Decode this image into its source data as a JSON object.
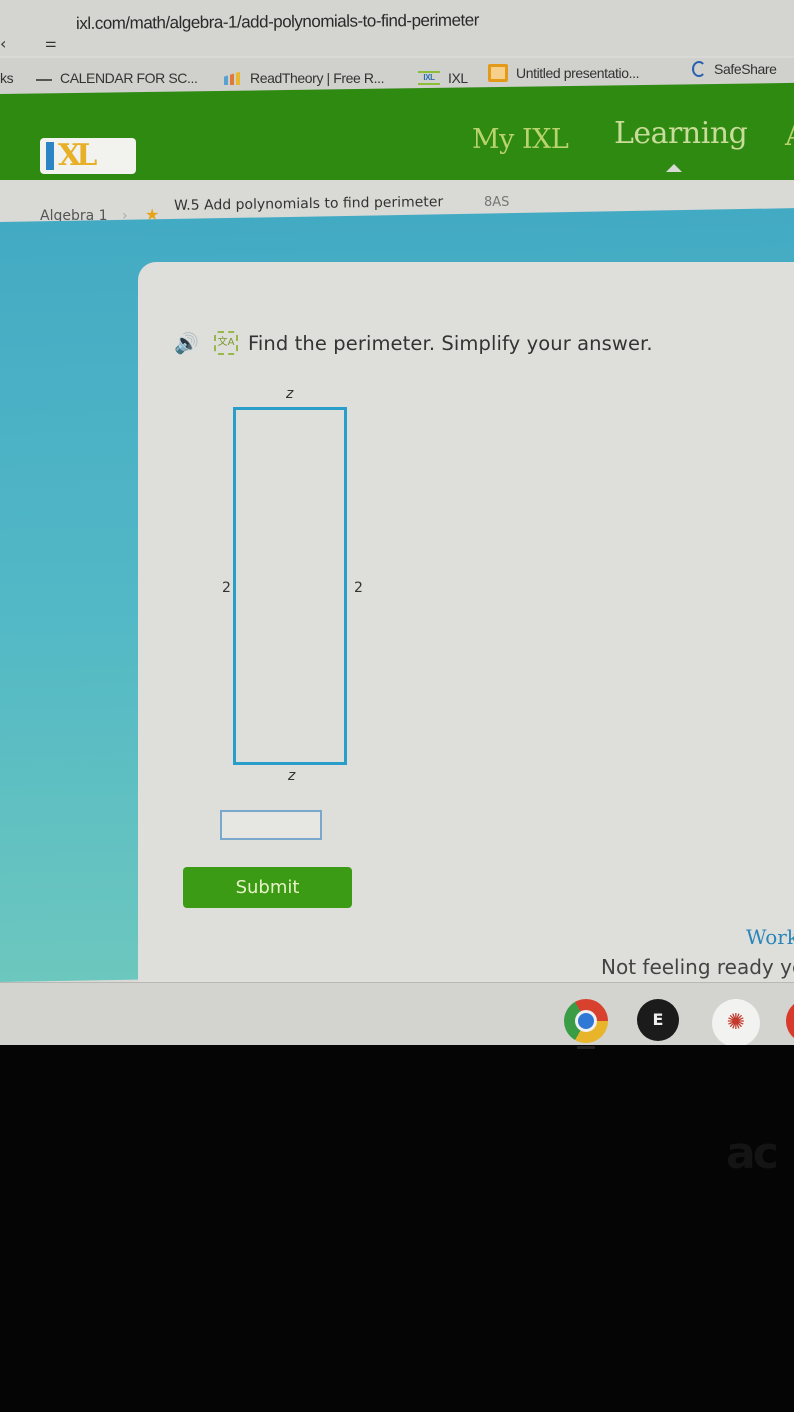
{
  "browser": {
    "url": "ixl.com/math/algebra-1/add-polynomials-to-find-perimeter",
    "back_icon": "back-arrow-icon",
    "site_info_icon": "tune-icon",
    "bookmarks": [
      {
        "label": "ks",
        "icon": "none"
      },
      {
        "label": "CALENDAR FOR SC...",
        "icon": "calendar-line-icon"
      },
      {
        "label": "ReadTheory | Free R...",
        "icon": "readtheory-bars-icon"
      },
      {
        "label": "IXL",
        "icon": "ixl-icon"
      },
      {
        "label": "Untitled presentatio...",
        "icon": "google-slides-icon"
      },
      {
        "label": "SafeShare",
        "icon": "safeshare-icon"
      }
    ]
  },
  "ixl": {
    "logo_i": "I",
    "logo_xl": "XL",
    "nav": {
      "my_ixl": "My IXL",
      "learning": "Learning",
      "assessment_partial": "A"
    },
    "breadcrumb": {
      "subject": "Algebra 1",
      "separator": "›",
      "star": "★",
      "skill": "W.5 Add polynomials to find perimeter",
      "code": "8AS"
    },
    "colors": {
      "header_green": "#2f8a12",
      "teal": "#43aac4",
      "shape_blue": "#2a9ecb",
      "submit_green": "#3b9b14"
    }
  },
  "question": {
    "speaker_icon": "🔊",
    "translate_icon": "文A",
    "prompt": "Find the perimeter. Simplify your answer.",
    "diagram": {
      "shape": "rectangle",
      "top_label": "z",
      "bottom_label": "z",
      "left_label": "2",
      "right_label": "2"
    },
    "answer_value": "",
    "answer_placeholder": "",
    "submit_label": "Submit"
  },
  "sidebar_help": {
    "work_it_out": "Work it out",
    "not_ready": "Not feeling ready yet?"
  },
  "shelf": {
    "apps": [
      {
        "name": "Chrome",
        "active": true
      },
      {
        "name": "E",
        "label": "E"
      },
      {
        "name": "Canvas",
        "label": "✺"
      },
      {
        "name": "partial-app"
      }
    ]
  },
  "bezel_brand": "ac"
}
